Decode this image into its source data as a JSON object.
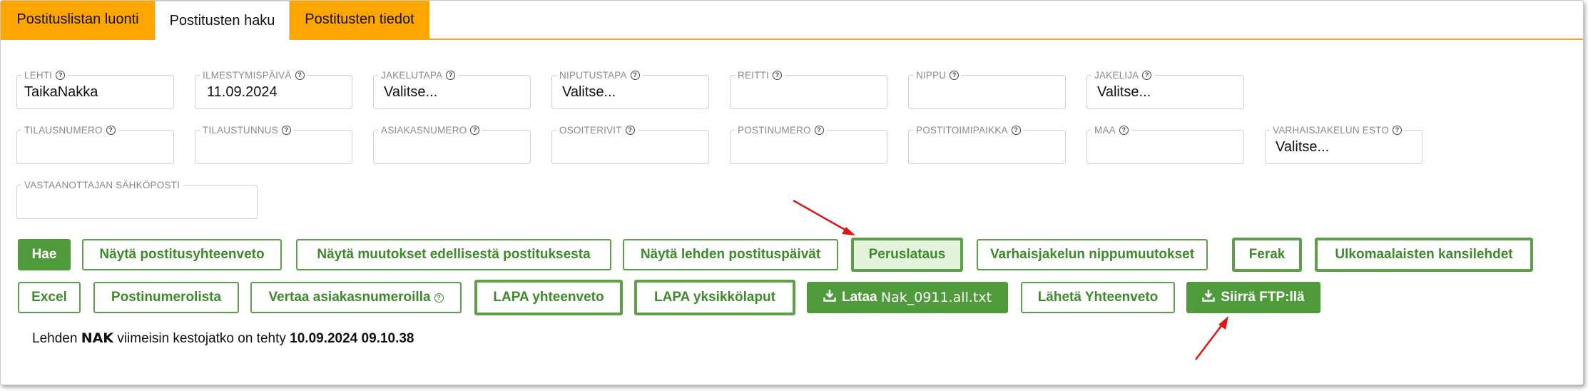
{
  "tabs": [
    {
      "label": "Postituslistan luonti",
      "active": false
    },
    {
      "label": "Postitusten haku",
      "active": true
    },
    {
      "label": "Postitusten tiedot",
      "active": false
    }
  ],
  "fields": {
    "lehti": {
      "label": "LEHTI",
      "value": "TaikaNakka"
    },
    "ilmestymispaiva": {
      "label": "ILMESTYMISPÄIVÄ",
      "value": "11.09.2024"
    },
    "jakelutapa": {
      "label": "JAKELUTAPA",
      "value": "Valitse..."
    },
    "niputustapa": {
      "label": "NIPUTUSTAPA",
      "value": "Valitse..."
    },
    "reitti": {
      "label": "REITTI",
      "value": ""
    },
    "nippu": {
      "label": "NIPPU",
      "value": ""
    },
    "jakelija": {
      "label": "JAKELIJA",
      "value": "Valitse..."
    },
    "tilausnumero": {
      "label": "TILAUSNUMERO",
      "value": ""
    },
    "tilaustunnus": {
      "label": "TILAUSTUNNUS",
      "value": ""
    },
    "asiakasnumero": {
      "label": "ASIAKASNUMERO",
      "value": ""
    },
    "osoiterivit": {
      "label": "OSOITERIVIT",
      "value": ""
    },
    "postinumero": {
      "label": "POSTINUMERO",
      "value": ""
    },
    "postitoimipaikka": {
      "label": "POSTITOIMIPAIKKA",
      "value": ""
    },
    "maa": {
      "label": "MAA",
      "value": ""
    },
    "varhaisjakelun_esto": {
      "label": "VARHAISJAKELUN ESTO",
      "value": "Valitse..."
    },
    "sahkoposti": {
      "label": "VASTAANOTTAJAN SÄHKÖPOSTI",
      "value": ""
    }
  },
  "help_icon": "?",
  "buttons": {
    "hae": "Hae",
    "nayta_yhteenveto": "Näytä postitusyhteenveto",
    "nayta_muutokset": "Näytä muutokset edellisestä postituksesta",
    "nayta_postituspaivat": "Näytä lehden postituspäivät",
    "peruslataus": "Peruslataus",
    "varhaisjakelun_nippumuutokset": "Varhaisjakelun nippumuutokset",
    "ferak": "Ferak",
    "ulkomaalaisten_kansilehdet": "Ulkomaalaisten kansilehdet",
    "excel": "Excel",
    "postinumerolista": "Postinumerolista",
    "vertaa_asiakasnumeroilla": "Vertaa asiakasnumeroilla",
    "lapa_yhteenveto": "LAPA yhteenveto",
    "lapa_yksikkolaput": "LAPA yksikkölaput",
    "lataa_prefix": "Lataa",
    "lataa_file": "Nak_0911.all.txt",
    "laheta_yhteenveto": "Lähetä Yhteenveto",
    "siirra_ftp": "Siirrä FTP:llä"
  },
  "status": {
    "prefix": "Lehden",
    "paper": "NAK",
    "middle": "viimeisin kestojatko on tehty",
    "timestamp": "10.09.2024 09.10.38"
  },
  "colors": {
    "tab_orange": "#ffa500",
    "green": "#4f9a3a",
    "arrow_red": "#e01515"
  }
}
